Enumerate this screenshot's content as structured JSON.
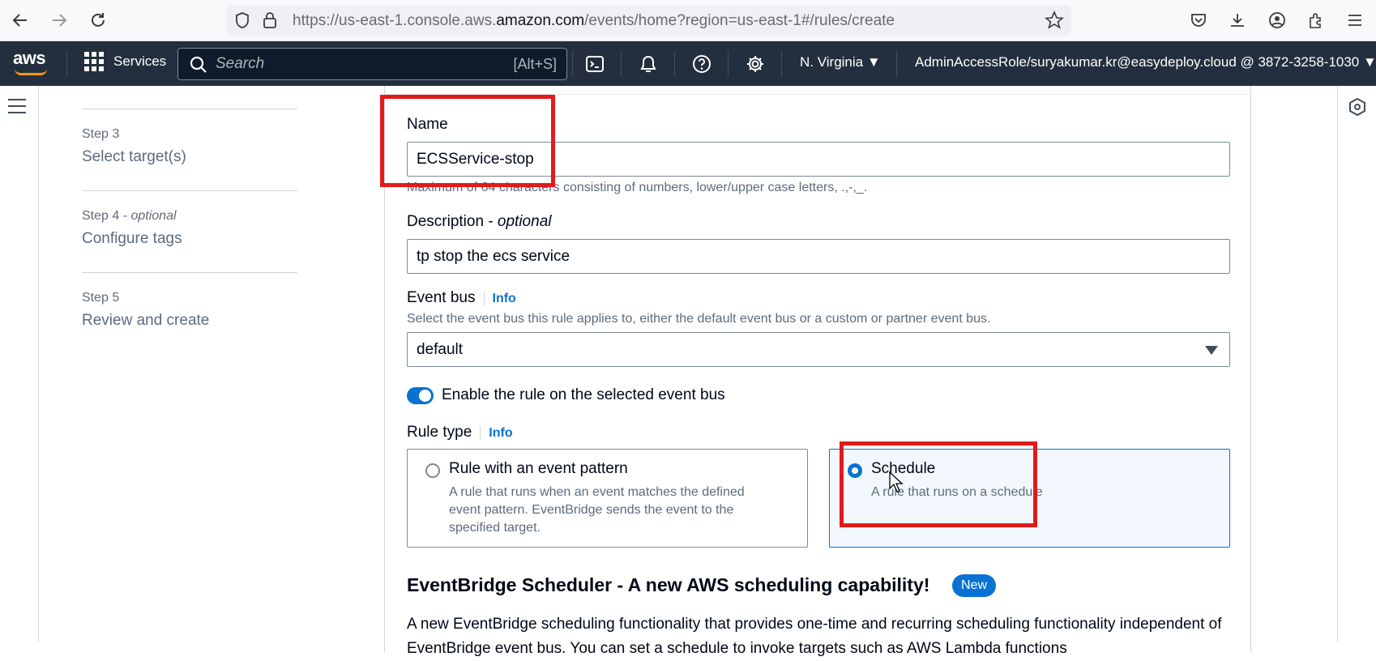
{
  "browser": {
    "url_prefix": "https://us-east-1.console.aws.",
    "url_domain": "amazon.com",
    "url_suffix": "/events/home?region=us-east-1#/rules/create"
  },
  "aws_nav": {
    "logo": "aws",
    "services_label": "Services",
    "search_placeholder": "Search",
    "search_shortcut": "[Alt+S]",
    "region": "N. Virginia",
    "account": "AdminAccessRole/suryakumar.kr@easydeploy.cloud @ 3872-3258-1030"
  },
  "steps": [
    {
      "num": "Step 3",
      "optional": "",
      "title": "Select target(s)"
    },
    {
      "num": "Step 4 - ",
      "optional": "optional",
      "title": "Configure tags"
    },
    {
      "num": "Step 5",
      "optional": "",
      "title": "Review and create"
    }
  ],
  "form": {
    "name_label": "Name",
    "name_value": "ECSService-stop",
    "name_hint": "Maximum of 64 characters consisting of numbers, lower/upper case letters, .,-,_.",
    "description_label": "Description - ",
    "description_optional": "optional",
    "description_value": "tp stop the ecs service",
    "event_bus_label": "Event bus",
    "info": "Info",
    "event_bus_hint": "Select the event bus this rule applies to, either the default event bus or a custom or partner event bus.",
    "event_bus_value": "default",
    "enable_label": "Enable the rule on the selected event bus",
    "enable_on": true,
    "rule_type_label": "Rule type",
    "rule_types": [
      {
        "title": "Rule with an event pattern",
        "desc": "A rule that runs when an event matches the defined event pattern. EventBridge sends the event to the specified target.",
        "selected": false
      },
      {
        "title": "Schedule",
        "desc": "A rule that runs on a schedule",
        "selected": true
      }
    ],
    "scheduler_heading": "EventBridge Scheduler - A new AWS scheduling capability!",
    "new_badge": "New",
    "scheduler_para": "A new EventBridge scheduling functionality that provides one-time and recurring scheduling functionality independent of EventBridge event bus. You can set a schedule to invoke targets such as AWS Lambda functions"
  },
  "colors": {
    "aws_nav_bg": "#232f3e",
    "accent": "#0972d3",
    "annotation_red": "#e01b1b"
  }
}
